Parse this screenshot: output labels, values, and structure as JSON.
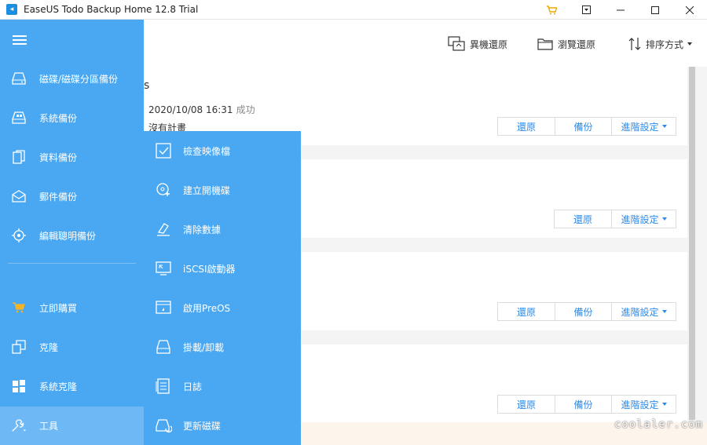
{
  "window": {
    "title": "EaseUS Todo Backup Home 12.8 Trial",
    "controls": [
      "cart-icon",
      "menu-icon",
      "minimize-icon",
      "maximize-icon",
      "close-icon"
    ]
  },
  "toolbar": {
    "restore_other": "異機還原",
    "browse_restore": "瀏覽還原",
    "sort": "排序方式"
  },
  "sidebar": {
    "items": [
      {
        "label": "磁碟/磁碟分區備份",
        "icon": "disk-backup-icon"
      },
      {
        "label": "系統備份",
        "icon": "system-backup-icon"
      },
      {
        "label": "資料備份",
        "icon": "file-backup-icon"
      },
      {
        "label": "郵件備份",
        "icon": "mail-backup-icon"
      },
      {
        "label": "編輯聰明備份",
        "icon": "smart-backup-icon"
      },
      {
        "label": "立即購買",
        "icon": "cart-icon"
      },
      {
        "label": "克隆",
        "icon": "clone-icon"
      },
      {
        "label": "系統克隆",
        "icon": "system-clone-icon"
      },
      {
        "label": "工具",
        "icon": "wrench-icon"
      }
    ]
  },
  "submenu": {
    "items": [
      {
        "label": "檢查映像檔",
        "icon": "check-image-icon"
      },
      {
        "label": "建立開機碟",
        "icon": "create-boot-disk-icon"
      },
      {
        "label": "清除數據",
        "icon": "wipe-data-icon"
      },
      {
        "label": "iSCSI啟動器",
        "icon": "iscsi-icon"
      },
      {
        "label": "啟用PreOS",
        "icon": "preos-icon"
      },
      {
        "label": "掛載/卸載",
        "icon": "mount-icon"
      },
      {
        "label": "日誌",
        "icon": "log-icon"
      },
      {
        "label": "更新磁碟",
        "icon": "refresh-disk-icon"
      }
    ]
  },
  "tasks": [
    {
      "title_fragment": "s",
      "last_time": "2020/10/08 16:31",
      "status": "成功",
      "schedule": "沒有計畫",
      "buttons": [
        "還原",
        "備份",
        "進階設定"
      ]
    },
    {
      "buttons": [
        "還原",
        "進階設定"
      ]
    },
    {
      "buttons": [
        "還原",
        "備份",
        "進階設定"
      ]
    },
    {
      "buttons": [
        "還原",
        "備份",
        "進階設定"
      ]
    }
  ],
  "watermark": "coolaler.com",
  "colors": {
    "sidebar": "#4aa8f2",
    "active": "#6db8f5",
    "link": "#2e8ae6"
  }
}
